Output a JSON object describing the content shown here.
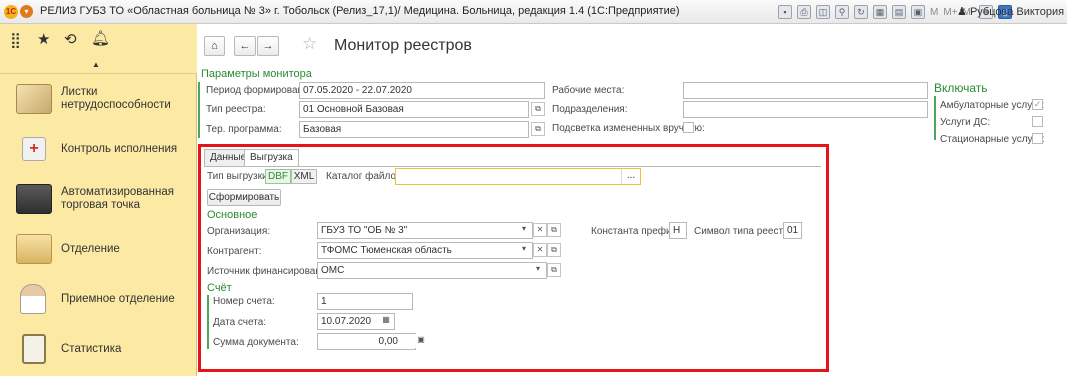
{
  "titlebar": {
    "logo": "1С",
    "title": "РЕЛИЗ ГУБЗ ТО «Областная больница № 3» г. Тобольск (Релиз_17,1)/ Медицина. Больница, редакция 1.4  (1С:Предприятие)",
    "toolbar_text": [
      "M",
      "M+",
      "M-"
    ],
    "user": "Рубцова Виктория"
  },
  "sidebar": {
    "items": [
      {
        "label": "Листки нетрудоспособности",
        "icon": "sick-leave-icon"
      },
      {
        "label": "Контроль исполнения",
        "icon": "first-aid-icon"
      },
      {
        "label": "Автоматизированная торговая точка",
        "icon": "cash-register-icon"
      },
      {
        "label": "Отделение",
        "icon": "bed-icon"
      },
      {
        "label": "Приемное отделение",
        "icon": "doctor-icon"
      },
      {
        "label": "Статистика",
        "icon": "clipboard-icon"
      }
    ]
  },
  "header": {
    "title": "Монитор реестров"
  },
  "params": {
    "group_title": "Параметры монитора",
    "period_label": "Период формирования:",
    "period_value": "07.05.2020 - 22.07.2020",
    "type_label": "Тип реестра:",
    "type_value": "01 Основной Базовая",
    "program_label": "Тер. программа:",
    "program_value": "Базовая",
    "workplaces_label": "Рабочие места:",
    "workplaces_value": "",
    "departments_label": "Подразделения:",
    "departments_value": "",
    "highlight_label": "Подсветка измененных вручную:"
  },
  "include": {
    "title": "Включать",
    "ambulatory": "Амбулаторные услуги:",
    "ds": "Услуги ДС:",
    "stationary": "Стационарные услуги:"
  },
  "tabs": {
    "data": "Данные",
    "export": "Выгрузка"
  },
  "export": {
    "type_label": "Тип выгрузки:",
    "dbf": "DBF",
    "xml": "XML",
    "catalog_label": "Каталог файлов:",
    "catalog_value": "",
    "catalog_button": "...",
    "generate_button": "Сформировать"
  },
  "main_section": {
    "title": "Основное",
    "org_label": "Организация:",
    "org_value": "ГБУЗ ТО \"ОБ № 3\"",
    "contractor_label": "Контрагент:",
    "contractor_value": "ТФОМС Тюменская область",
    "source_label": "Источник финансирования:",
    "source_value": "ОМС",
    "prefix_label": "Константа префикс:",
    "prefix_value": "Н",
    "symbol_label": "Символ типа реестра:",
    "symbol_value": "01"
  },
  "invoice": {
    "title": "Счёт",
    "number_label": "Номер счета:",
    "number_value": "1",
    "date_label": "Дата счета:",
    "date_value": "10.07.2020",
    "sum_label": "Сумма документа:",
    "sum_value": "0,00"
  },
  "colors": {
    "sidebar_bg": "#fbe9a4",
    "group_green": "#2b8a34",
    "highlight_red": "#e4141a",
    "active_field_border": "#f0c33c"
  }
}
